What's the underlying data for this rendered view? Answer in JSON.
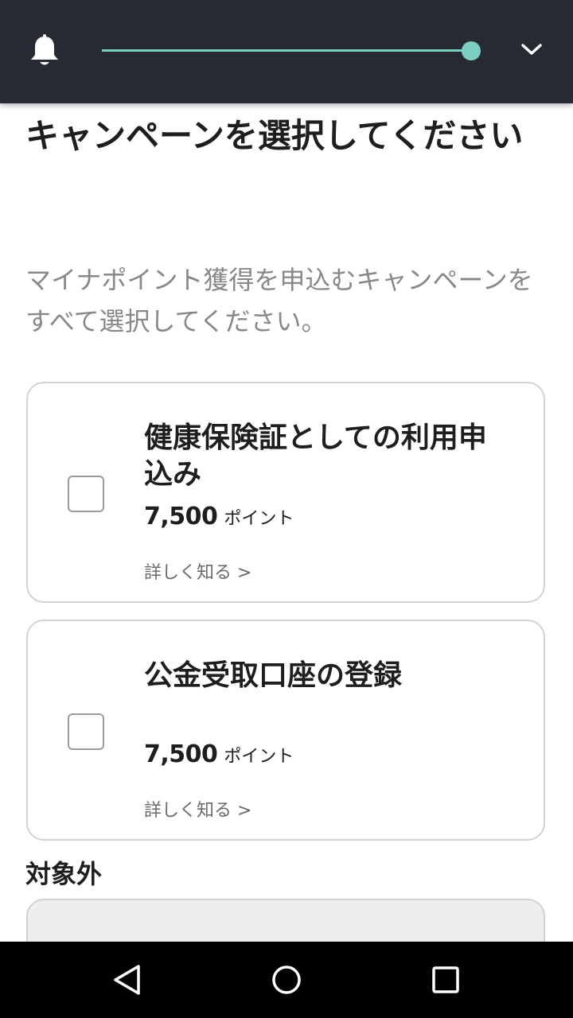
{
  "header": {
    "bell_icon": "bell-icon",
    "progress_fraction": 1.0,
    "progress_color": "#7dd0c1",
    "background_color": "#262b33",
    "menu_icon": "chevron-down-icon"
  },
  "page": {
    "title": "キャンペーンを選択してください",
    "description": "マイナポイント獲得を申込むキャンペーンをすべて選択してください。"
  },
  "campaigns": [
    {
      "title": "健康保険証としての利用申込み",
      "checked": false,
      "points_value": "7,500",
      "points_unit": "ポイント",
      "detail_link": "詳しく知る >"
    },
    {
      "title": "公金受取口座の登録",
      "checked": false,
      "points_value": "7,500",
      "points_unit": "ポイント",
      "detail_link": "詳しく知る >"
    }
  ],
  "excluded_section": {
    "heading": "対象外"
  },
  "navbar": {
    "back_icon": "back-triangle-icon",
    "home_icon": "home-circle-icon",
    "recents_icon": "recents-square-icon"
  }
}
